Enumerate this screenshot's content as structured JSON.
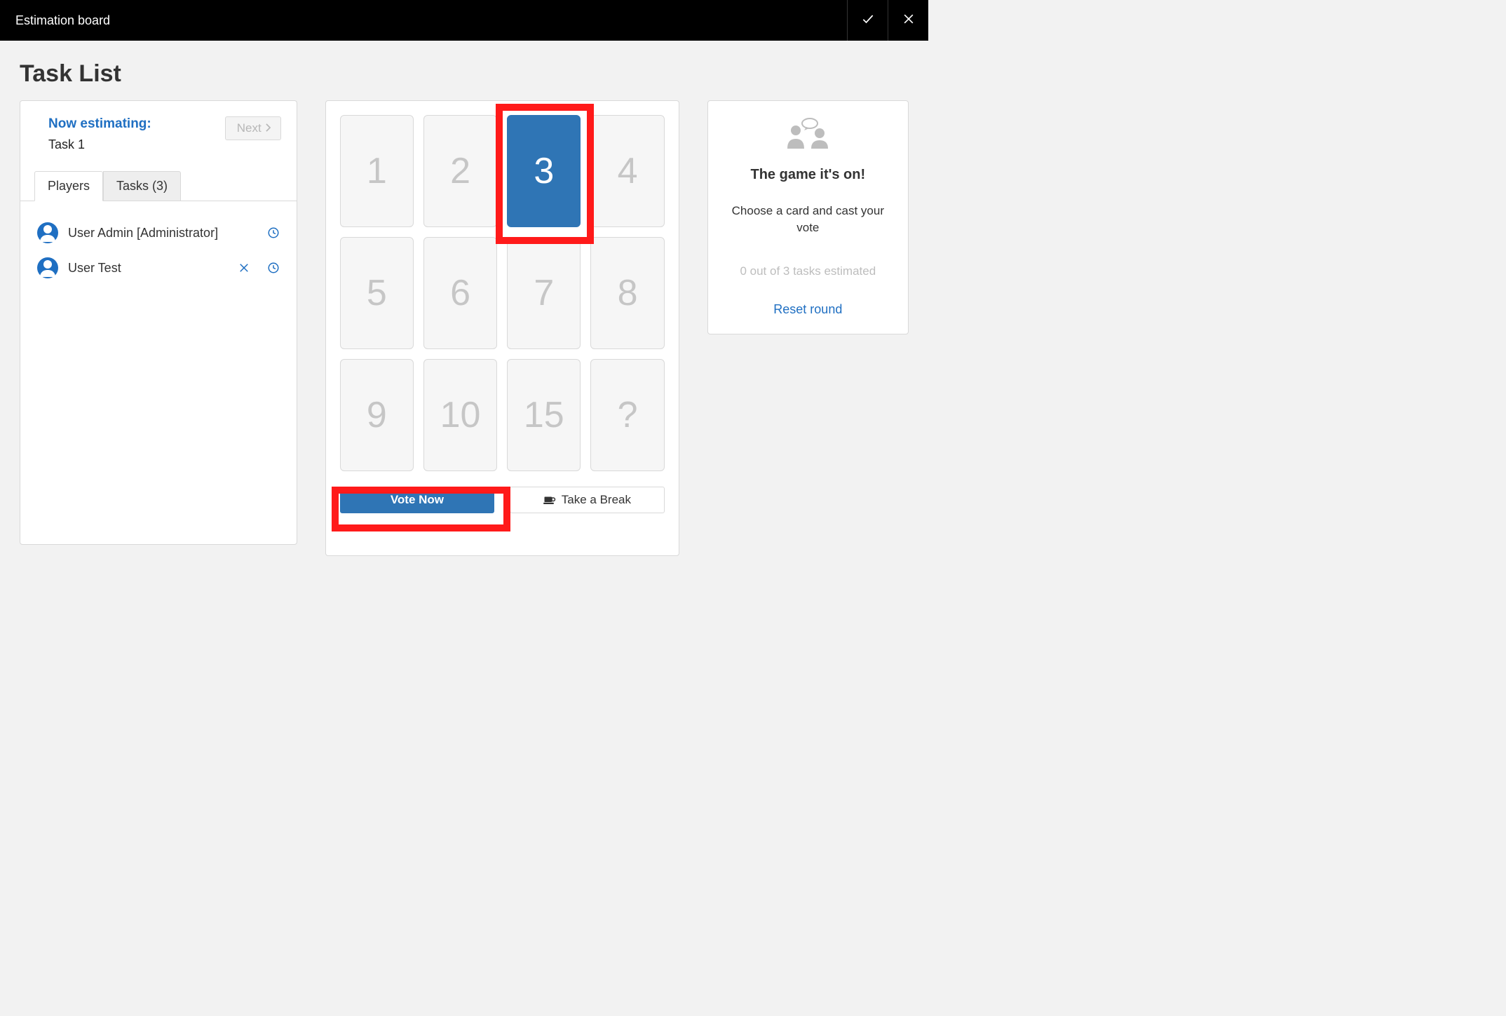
{
  "topbar": {
    "title": "Estimation board"
  },
  "page": {
    "title": "Task List"
  },
  "left": {
    "now_estimating_label": "Now estimating:",
    "current_task": "Task 1",
    "next_label": "Next",
    "tabs": {
      "players": "Players",
      "tasks": "Tasks (3)"
    },
    "players": [
      {
        "name": "User Admin [Administrator]",
        "remove": false,
        "pending": true
      },
      {
        "name": "User Test",
        "remove": true,
        "pending": true
      }
    ]
  },
  "cards": [
    "1",
    "2",
    "3",
    "4",
    "5",
    "6",
    "7",
    "8",
    "9",
    "10",
    "15",
    "?"
  ],
  "selected_card_index": 2,
  "actions": {
    "vote": "Vote Now",
    "break": "Take a Break"
  },
  "right": {
    "headline": "The game it's on!",
    "description": "Choose a card and cast your vote",
    "progress": "0 out of 3 tasks estimated",
    "reset": "Reset round"
  }
}
